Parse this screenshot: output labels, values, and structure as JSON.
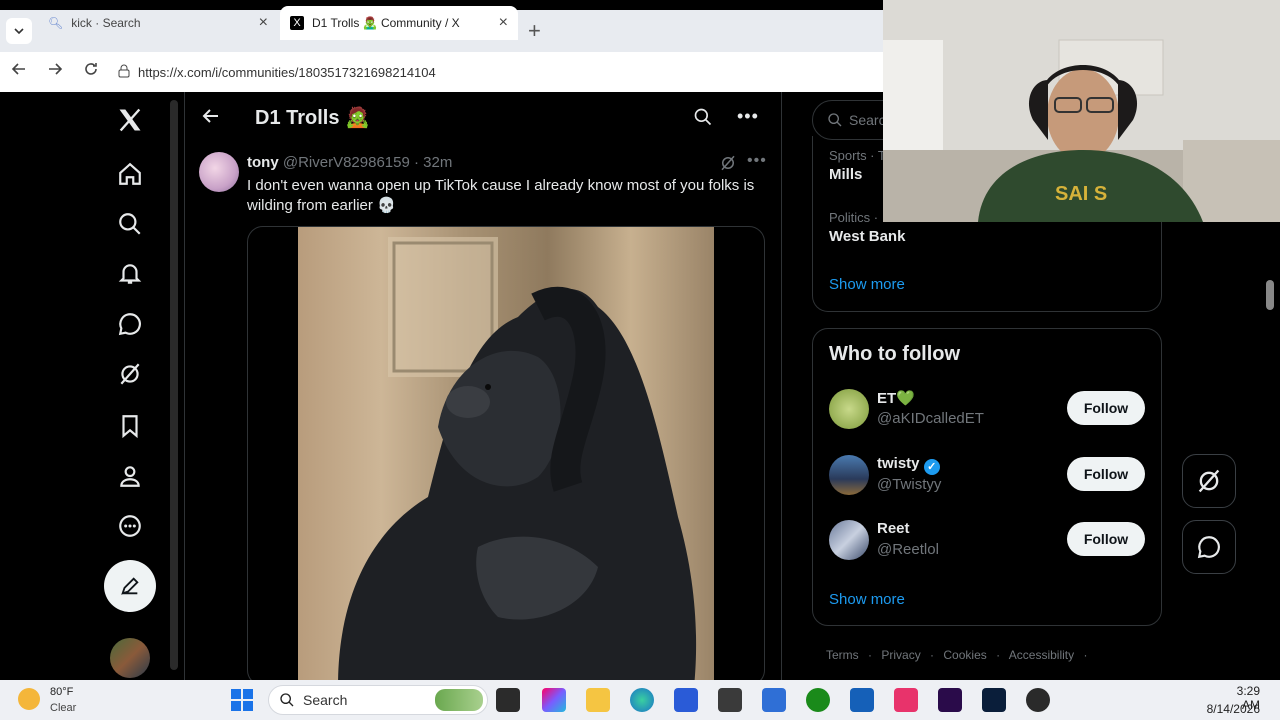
{
  "browser": {
    "tabs": [
      {
        "label": "kick · Search"
      },
      {
        "label": "D1 Trolls 🧟‍♂️ Community / X"
      }
    ],
    "url": "https://x.com/i/communities/1803517321698214104"
  },
  "header": {
    "title": "D1 Trolls 🧟"
  },
  "tweet": {
    "author_name": "tony",
    "author_handle": "@RiverV82986159",
    "time": "· 32m",
    "text": "I don't even wanna open up TikTok cause I already know most of you folks is wilding from earlier 💀"
  },
  "right": {
    "search_placeholder": "Search",
    "trends": [
      {
        "category": "Sports · T",
        "name": "Mills"
      },
      {
        "category": "Politics ·",
        "name": "West Bank"
      }
    ],
    "show_more": "Show more",
    "who_to_follow": {
      "title": "Who to follow",
      "suggestions": [
        {
          "name": "ET💚",
          "handle": "@aKIDcalledET",
          "button": "Follow"
        },
        {
          "name": "twisty",
          "handle": "@Twistyy",
          "button": "Follow",
          "verified": true
        },
        {
          "name": "Reet",
          "handle": "@Reetlol",
          "button": "Follow"
        }
      ],
      "show_more": "Show more"
    },
    "footer": [
      "Terms",
      "Privacy",
      "Cookies",
      "Accessibility",
      "·"
    ]
  },
  "taskbar": {
    "weather_temp": "80°F",
    "weather_desc": "Clear",
    "search": "Search",
    "time": "3:29 AM",
    "date": "8/14/2026"
  },
  "colors": {
    "accent": "#1d9bf0",
    "text": "#e7e9ea",
    "muted": "#71767b",
    "border": "#2f3336"
  }
}
